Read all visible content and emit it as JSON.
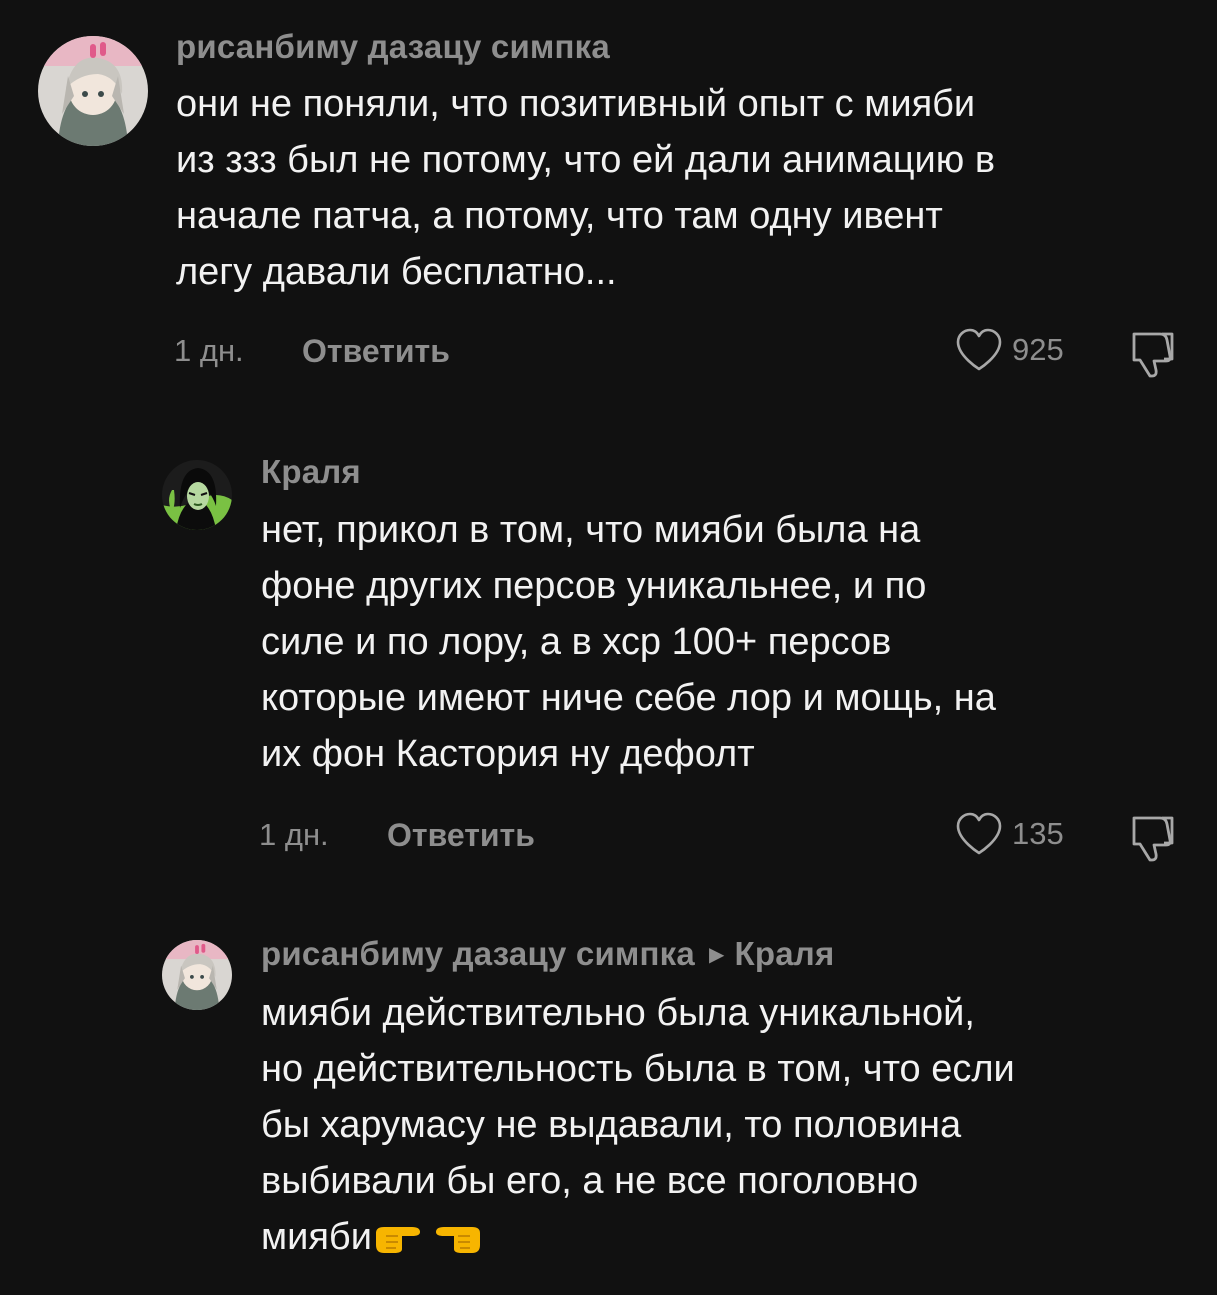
{
  "comments": [
    {
      "author": "рисанбиму дазацу симпка",
      "lines": [
        "они не поняли, что позитивный опыт с мияби",
        "из ззз был не потому, что ей дали анимацию в",
        "начале патча, а потому, что там одну ивент",
        "легу давали бесплатно..."
      ],
      "time": "1 дн.",
      "reply_label": "Ответить",
      "likes": "925",
      "avatar": "anime-avatar-icon"
    },
    {
      "author": "Краля",
      "lines": [
        "нет, прикол в том, что мияби была на",
        "фоне других персов уникальнее, и по",
        "силе и по лору, а в хср 100+ персов",
        "которые имеют ниче себе лор и мощь, на",
        "их фон Кастория ну дефолт"
      ],
      "time": "1 дн.",
      "reply_label": "Ответить",
      "likes": "135",
      "avatar": "shego-avatar-icon"
    },
    {
      "author": "рисанбиму дазацу симпка",
      "reply_to": "Краля",
      "lines": [
        "мияби действительно была уникальной,",
        "но действительность была в том, что если",
        "бы харумасу не выдавали, то половина",
        "выбивали бы его, а не все поголовно",
        "мияби"
      ],
      "emoji": [
        "backhand-index-pointing-right-icon",
        "backhand-index-pointing-left-icon"
      ],
      "avatar": "anime-avatar-icon"
    }
  ],
  "colors": {
    "background": "#111111",
    "text": "#f2f2f2",
    "muted": "#8e8e8e"
  }
}
